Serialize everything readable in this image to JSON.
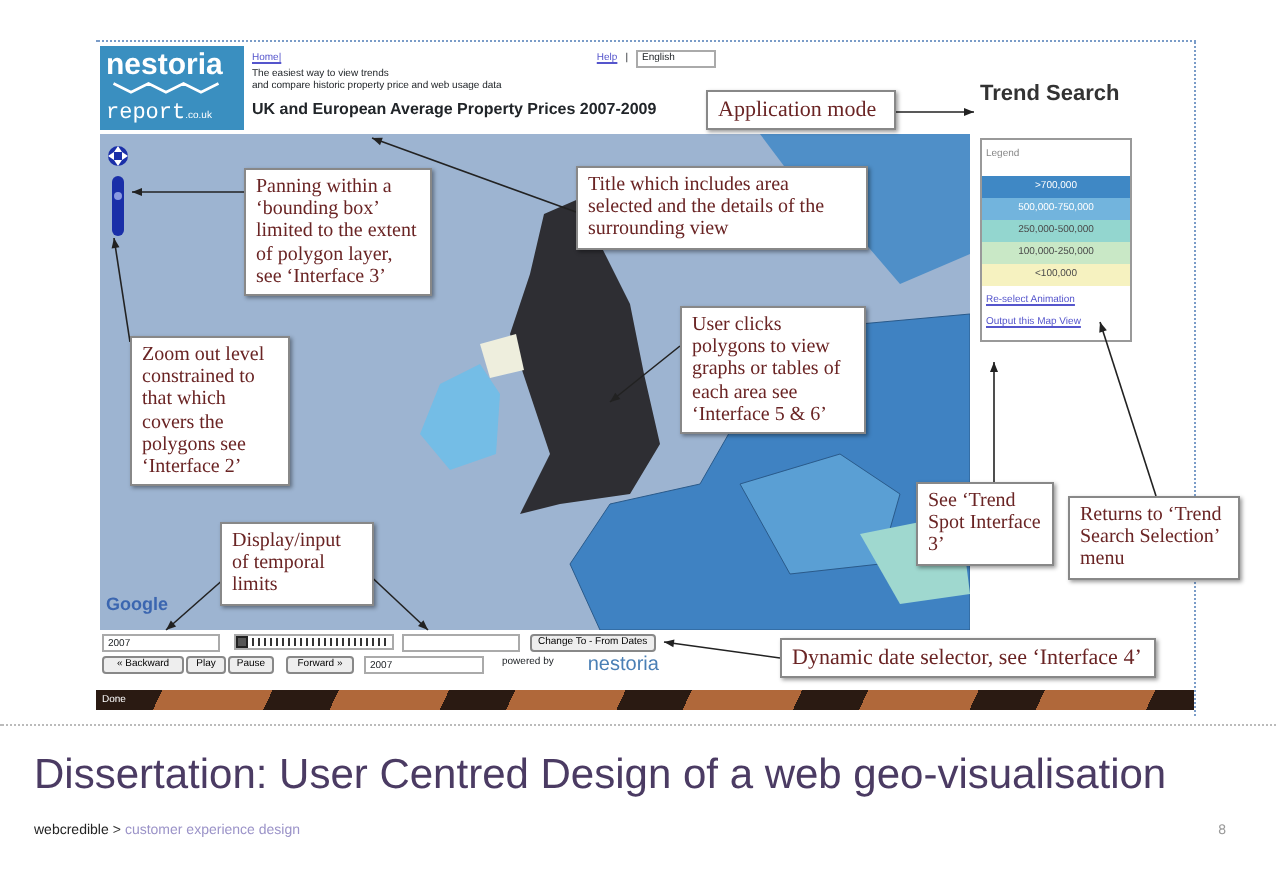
{
  "screenshot": {
    "logo": {
      "wordmark": "nestoria",
      "subtitle": "report",
      "domain": ".co.uk"
    },
    "home_link": "Home|",
    "tagline": [
      "The easiest way to view trends",
      "and compare historic property price and web usage data"
    ],
    "page_title": "UK and European Average Property Prices 2007-2009",
    "help_link": "Help",
    "separator": "|",
    "language": "English",
    "mode_title": "Trend Search",
    "legend": {
      "title": "Legend",
      "items": [
        {
          "label": ">700,000",
          "color": "#3f88c5"
        },
        {
          "label": "500,000-750,000",
          "color": "#72b4dd"
        },
        {
          "label": "250,000-500,000",
          "color": "#93d6cf"
        },
        {
          "label": "100,000-250,000",
          "color": "#c9e8c6"
        },
        {
          "label": "<100,000",
          "color": "#f6f2c0"
        }
      ]
    },
    "legend_links": [
      "Re-select Animation",
      "Output this Map View"
    ],
    "map": {
      "attribution": "Google"
    },
    "controls": {
      "from_date": "2007",
      "date_slider": {
        "level": 0
      },
      "change_button": "Change To - From Dates",
      "buttons": [
        "« Backward",
        "Play",
        "Pause",
        "Forward »"
      ],
      "current_date": "2007",
      "powered_by": "powered by",
      "brand": "nestoria"
    },
    "status": "Done"
  },
  "callouts": [
    {
      "text": "Application mode"
    },
    {
      "text": "Panning within a ‘bounding box’ limited to the extent of polygon layer, see ‘Interface 3’"
    },
    {
      "text": "Title which includes area selected and the details of the surrounding view"
    },
    {
      "text": "Zoom out level constrained to that which covers the polygons see ‘Interface 2’"
    },
    {
      "text": "User clicks polygons to view graphs or tables of each area see ‘Interface 5 & 6’"
    },
    {
      "text": "Display/input of temporal limits"
    },
    {
      "text": "See ‘Trend Spot Interface 3’"
    },
    {
      "text": "Returns to ‘Trend Search Selection’ menu"
    },
    {
      "text": "Dynamic date selector, see ‘Interface 4’"
    }
  ],
  "slide": {
    "title": "Dissertation: User Centred Design of a web geo-visualisation",
    "breadcrumb": [
      "webcredible",
      ">",
      "customer experience design"
    ],
    "page_number": "8"
  }
}
